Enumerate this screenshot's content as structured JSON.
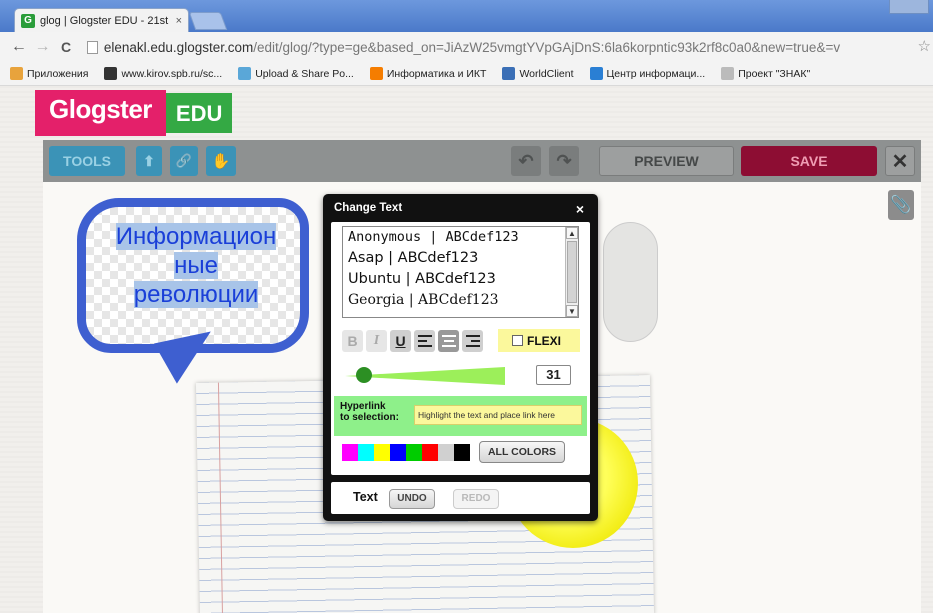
{
  "browser": {
    "tab_title": "glog | Glogster EDU - 21st",
    "tab_close": "×",
    "favicon_letter": "G",
    "url_domain": "elenakl.edu.glogster.com",
    "url_path": "/edit/glog/?type=ge&based_on=JiAzW25vmgtYVpGAjDnS:6la6korpntic93k2rf8c0a0&new=true&=v",
    "back": "←",
    "forward": "→",
    "reload": "C",
    "star": "☆"
  },
  "bookmarks": [
    {
      "label": "Приложения",
      "icon": "apps-icon",
      "color": "#e8a33c"
    },
    {
      "label": "www.kirov.spb.ru/sc...",
      "icon": "kirov-icon",
      "color": "#333333"
    },
    {
      "label": "Upload & Share Po...",
      "icon": "upload-icon",
      "color": "#5aa7d8"
    },
    {
      "label": "Информатика и ИКТ",
      "icon": "blogger-icon",
      "color": "#f57d00"
    },
    {
      "label": "WorldClient",
      "icon": "globe-icon",
      "color": "#3b6fb6"
    },
    {
      "label": "Центр информаци...",
      "icon": "wifi-icon",
      "color": "#2a7fd4"
    },
    {
      "label": "Проект \"ЗНАК\"",
      "icon": "page-icon",
      "color": "#bbbbbb"
    }
  ],
  "logo": {
    "part1": "Glogster",
    "part2": "EDU"
  },
  "editbar": {
    "tools": "TOOLS",
    "up": "⬆",
    "link": "🔗",
    "hand": "✋",
    "undo": "↶",
    "redo": "↷",
    "preview": "PREVIEW",
    "save": "SAVE",
    "close": "✕"
  },
  "canvas": {
    "bubble_lines": [
      "Информацион",
      "ные",
      "революции"
    ],
    "paperclip": "📎"
  },
  "dialog": {
    "title": "Change Text",
    "close": "×",
    "fonts": [
      "Anonymous | ABCdef123",
      "Asap | ABCdef123",
      "Ubuntu | ABCdef123",
      "Georgia | ABCdef123"
    ],
    "bold": "B",
    "italic": "I",
    "underline": "U",
    "flexi": "FLEXI",
    "size": "31",
    "size_fraction": 0.12,
    "hyperlink_label_1": "Hyperlink",
    "hyperlink_label_2": "to selection:",
    "hyperlink_placeholder": "Highlight the text and place link here",
    "colors": [
      "#ff00ff",
      "#00ffff",
      "#ffff00",
      "#0000ff",
      "#00cc00",
      "#ff0000",
      "#d0d0d0",
      "#000000"
    ],
    "all_colors": "ALL COLORS",
    "bottom_label": "Text",
    "undo": "UNDO",
    "redo": "REDO"
  }
}
